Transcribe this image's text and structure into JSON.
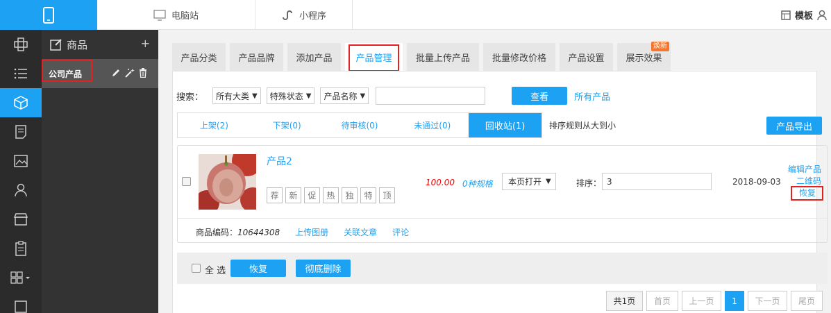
{
  "topbar": {
    "pc_label": "电脑站",
    "mini_label": "小程序",
    "template_label": "模板"
  },
  "sidebar": {
    "heading": "商品",
    "add_label": "+",
    "item_label": "公司产品"
  },
  "tabs": [
    {
      "label": "产品分类"
    },
    {
      "label": "产品品牌"
    },
    {
      "label": "添加产品"
    },
    {
      "label": "产品管理"
    },
    {
      "label": "批量上传产品"
    },
    {
      "label": "批量修改价格"
    },
    {
      "label": "产品设置"
    },
    {
      "label": "展示效果",
      "badge": "焕新"
    }
  ],
  "search": {
    "label": "搜索：",
    "category": "所有大类",
    "status": "特殊状态",
    "field": "产品名称",
    "button": "查看",
    "all_link": "所有产品"
  },
  "status_tabs": [
    {
      "label": "上架(2)"
    },
    {
      "label": "下架(0)"
    },
    {
      "label": "待审核(0)"
    },
    {
      "label": "未通过(0)"
    },
    {
      "label": "回收站(1)"
    }
  ],
  "sort_note": "排序规则从大到小",
  "export_button": "产品导出",
  "product": {
    "name": "产品2",
    "tags": [
      "荐",
      "新",
      "促",
      "热",
      "独",
      "特",
      "顶"
    ],
    "price": "100.00",
    "specs": "0种规格",
    "open_mode": "本页打开",
    "sort_label": "排序：",
    "sort_value": "3",
    "date": "2018-09-03",
    "actions": {
      "edit": "编辑产品",
      "qrcode": "二维码",
      "restore": "恢复"
    },
    "code_label": "商品编码：",
    "code_value": "10644308",
    "upload_gallery": "上传图册",
    "related_articles": "关联文章",
    "comments": "评论"
  },
  "bulk": {
    "select_all": "全 选",
    "restore": "恢复",
    "delete": "彻底删除"
  },
  "pager": {
    "total": "共1页",
    "first": "首页",
    "prev": "上一页",
    "current": "1",
    "next": "下一页",
    "last": "尾页"
  },
  "colors": {
    "accent": "#1da1f2",
    "highlight_box": "#e52020",
    "price": "#e00000",
    "badge": "#f5772d"
  }
}
